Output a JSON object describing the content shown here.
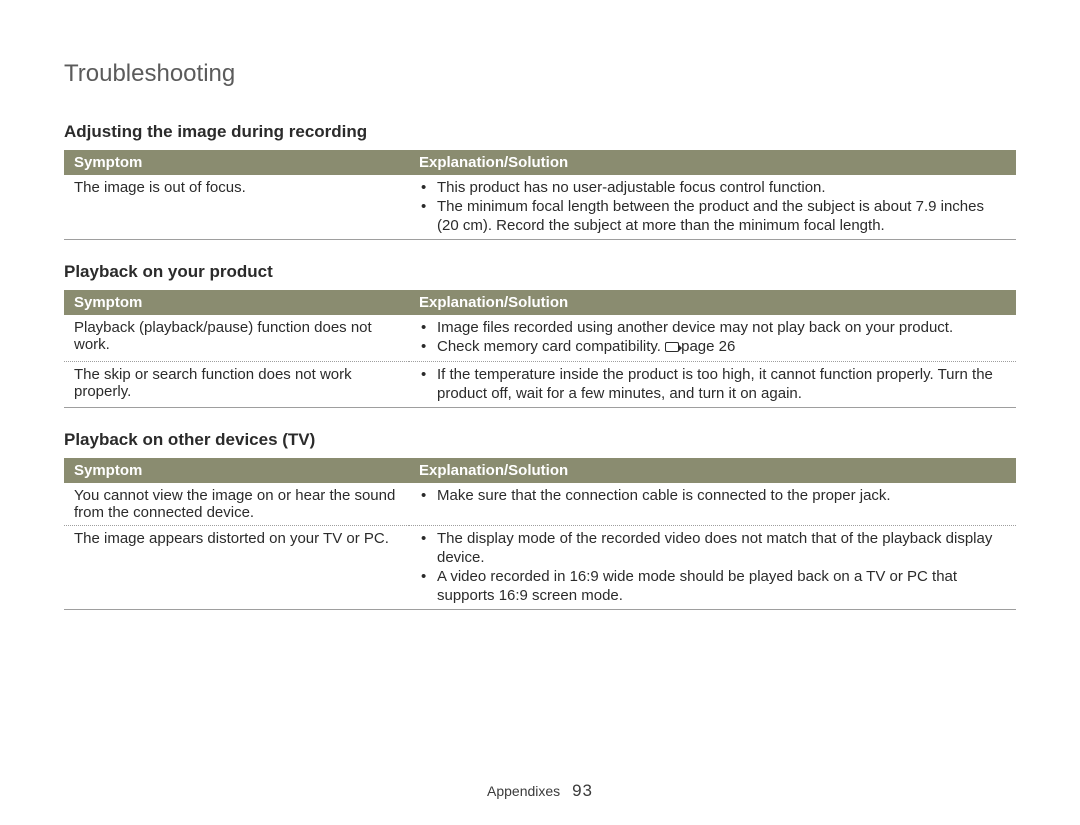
{
  "title": "Troubleshooting",
  "sections": [
    {
      "heading": "Adjusting the image during recording",
      "columns": {
        "symptom": "Symptom",
        "solution": "Explanation/Solution"
      },
      "rows": [
        {
          "symptom": "The image is out of focus.",
          "solutions": [
            "This product has no user-adjustable focus control function.",
            "The minimum focal length between the product and the subject is about 7.9 inches (20 cm). Record the subject at more than the minimum focal length."
          ]
        }
      ]
    },
    {
      "heading": "Playback on your product",
      "columns": {
        "symptom": "Symptom",
        "solution": "Explanation/Solution"
      },
      "rows": [
        {
          "symptom": "Playback (playback/pause) function does not work.",
          "solutions": [
            "Image files recorded using another device may not play back on your product.",
            {
              "text": "Check memory card compatibility. ",
              "pageref": "page 26"
            }
          ]
        },
        {
          "symptom": "The skip or search function does not work properly.",
          "solutions": [
            "If the temperature inside the product is too high, it cannot function properly. Turn the product off, wait for a few minutes, and turn it on again."
          ]
        }
      ]
    },
    {
      "heading": "Playback on other devices (TV)",
      "columns": {
        "symptom": "Symptom",
        "solution": "Explanation/Solution"
      },
      "rows": [
        {
          "symptom": "You cannot view the image on or hear the sound from the connected device.",
          "solutions": [
            "Make sure that the connection cable is connected to the proper jack."
          ]
        },
        {
          "symptom": "The image appears distorted on your TV or PC.",
          "solutions": [
            "The display mode of the recorded video does not match that of the playback display device.",
            "A video recorded in 16:9 wide mode should be played back on a TV or PC that supports 16:9 screen mode."
          ]
        }
      ]
    }
  ],
  "footer": {
    "section": "Appendixes",
    "page": "93"
  }
}
